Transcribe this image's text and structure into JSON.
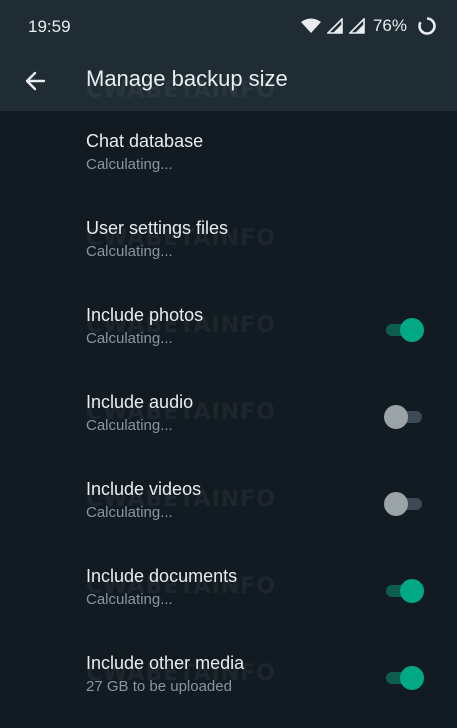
{
  "status_bar": {
    "time": "19:59",
    "battery_percent": "76%",
    "icons": [
      "wifi-icon",
      "signal-icon",
      "signal-icon",
      "battery-ring-icon"
    ]
  },
  "toolbar": {
    "back_icon": "arrow-left-icon",
    "title": "Manage backup size"
  },
  "items": [
    {
      "label": "Chat database",
      "sub": "Calculating...",
      "toggle": null
    },
    {
      "label": "User settings files",
      "sub": "Calculating...",
      "toggle": null
    },
    {
      "label": "Include photos",
      "sub": "Calculating...",
      "toggle": true
    },
    {
      "label": "Include audio",
      "sub": "Calculating...",
      "toggle": false
    },
    {
      "label": "Include videos",
      "sub": "Calculating...",
      "toggle": false
    },
    {
      "label": "Include documents",
      "sub": "Calculating...",
      "toggle": true
    },
    {
      "label": "Include other media",
      "sub": "27 GB to be uploaded",
      "toggle": true
    }
  ],
  "watermark_text": "CWABETAINFO",
  "colors": {
    "background": "#121b22",
    "toolbar": "#1f2c34",
    "accent": "#00a884",
    "secondary_text": "#8696a0"
  }
}
